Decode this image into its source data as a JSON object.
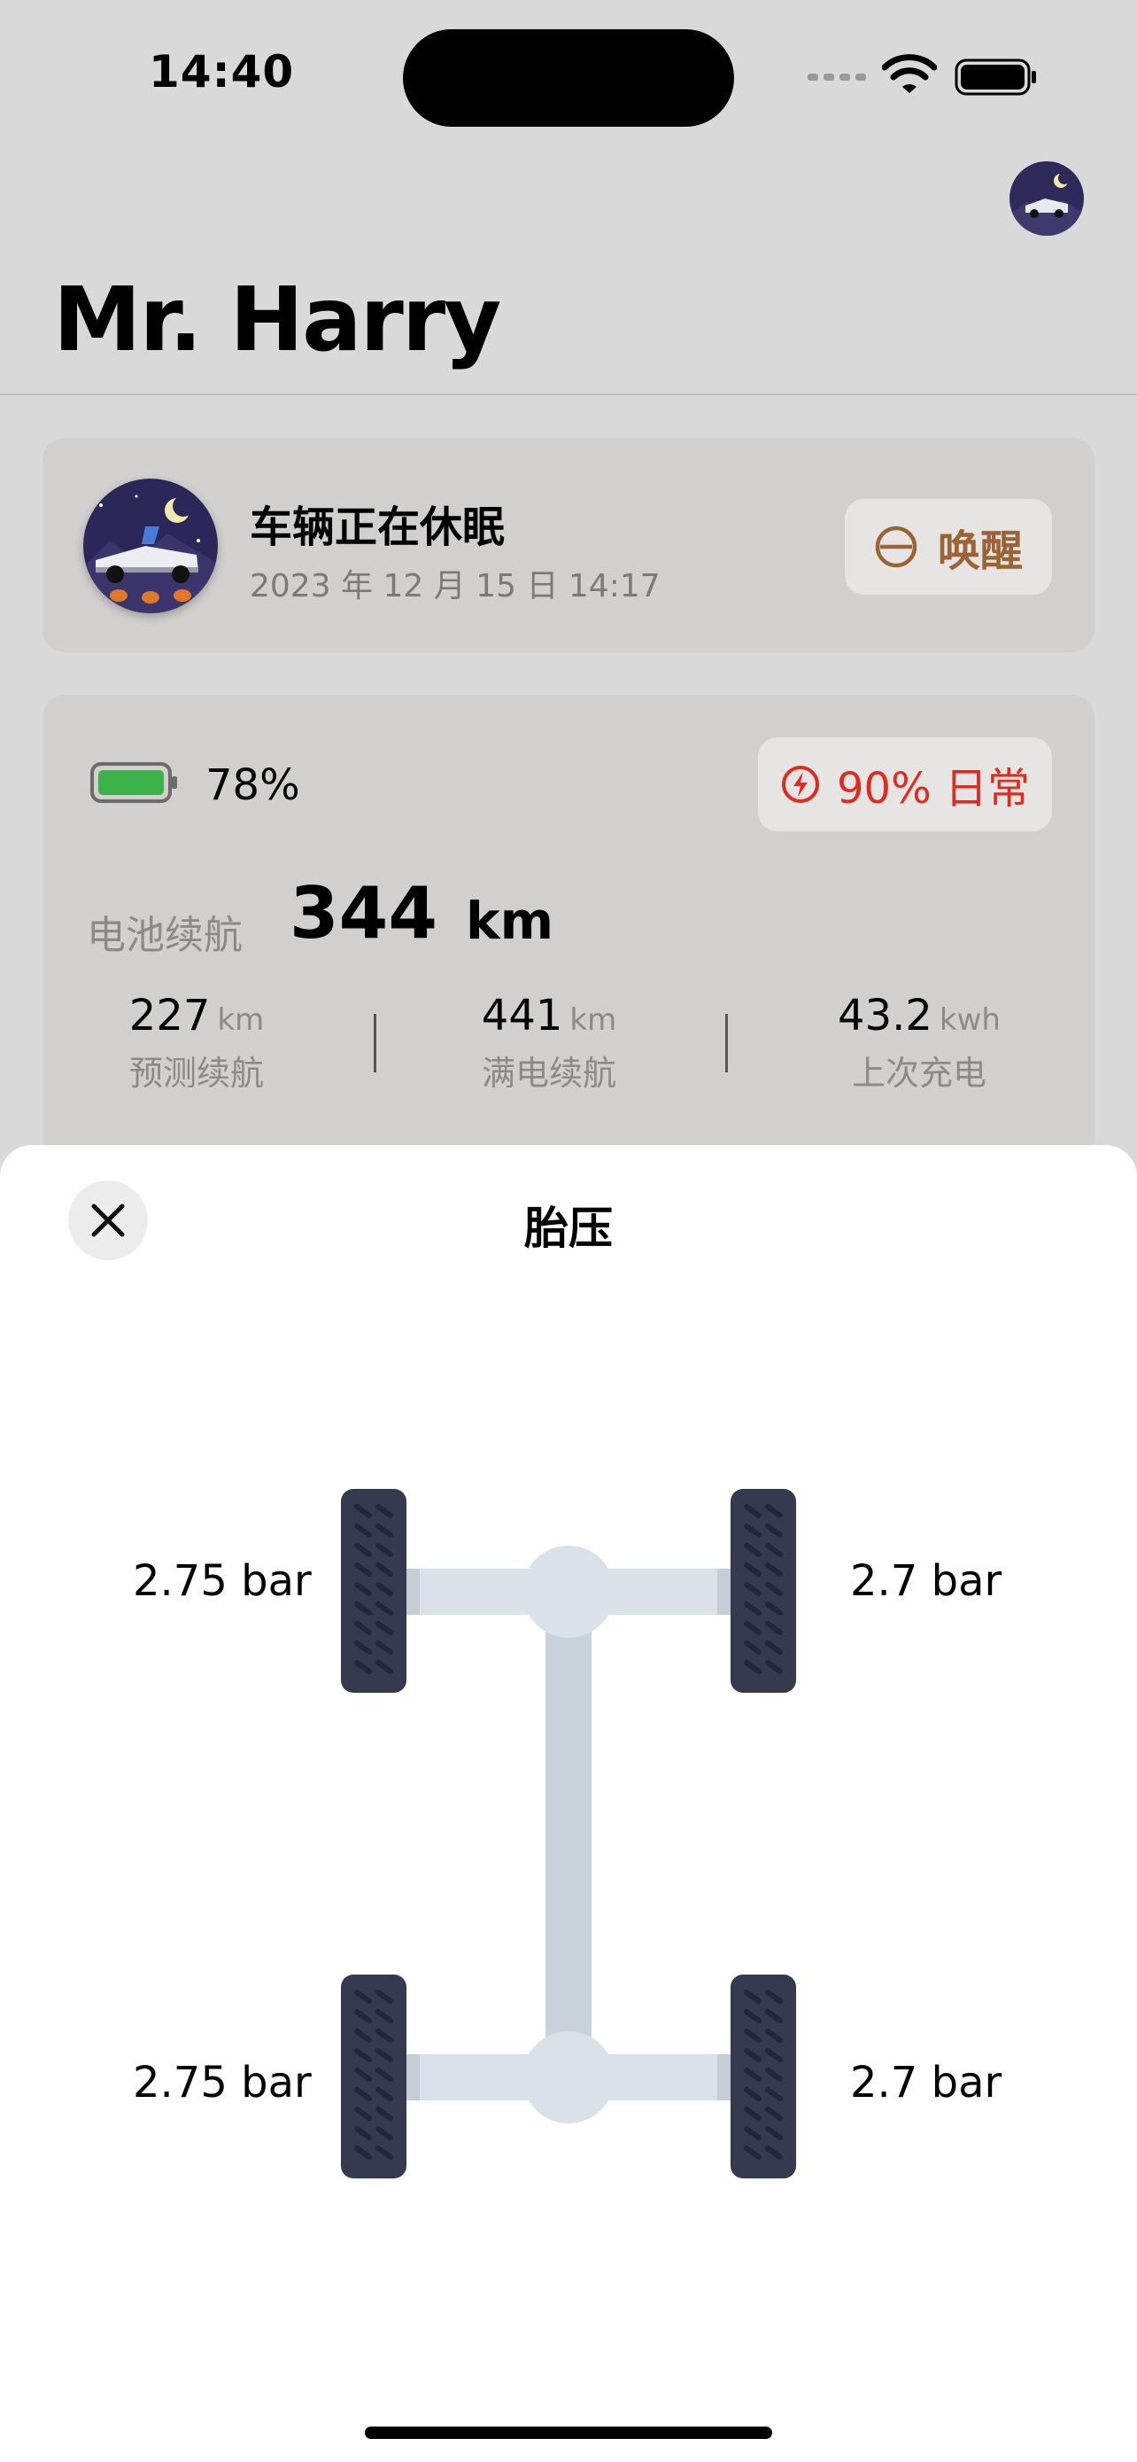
{
  "status_bar": {
    "time": "14:40"
  },
  "header": {
    "title": "Mr. Harry"
  },
  "vehicle_status": {
    "title": "车辆正在休眠",
    "timestamp": "2023 年 12 月 15 日 14:17",
    "wake_label": "唤醒"
  },
  "battery": {
    "percent": "78%",
    "charge_limit": "90% 日常",
    "range_label": "电池续航",
    "range_value": "344",
    "range_unit": "km",
    "stats": [
      {
        "value": "227",
        "unit": "km",
        "label": "预测续航"
      },
      {
        "value": "441",
        "unit": "km",
        "label": "满电续航"
      },
      {
        "value": "43.2",
        "unit": "kwh",
        "label": "上次充电"
      }
    ]
  },
  "sheet": {
    "title": "胎压",
    "tires": {
      "front_left": "2.75 bar",
      "front_right": "2.7 bar",
      "rear_left": "2.75 bar",
      "rear_right": "2.7 bar"
    }
  },
  "colors": {
    "background": "#d9d9d9",
    "card": "#d1d0ce",
    "wake_accent": "#9a6436",
    "charge_accent": "#e02b20",
    "battery_fill": "#3cb24a",
    "tire": "#363a4f",
    "axle": "#d9dee6"
  },
  "icons": {
    "wake": "power-ring-icon",
    "charge": "lightning-bolt-icon",
    "close": "close-x-icon"
  }
}
